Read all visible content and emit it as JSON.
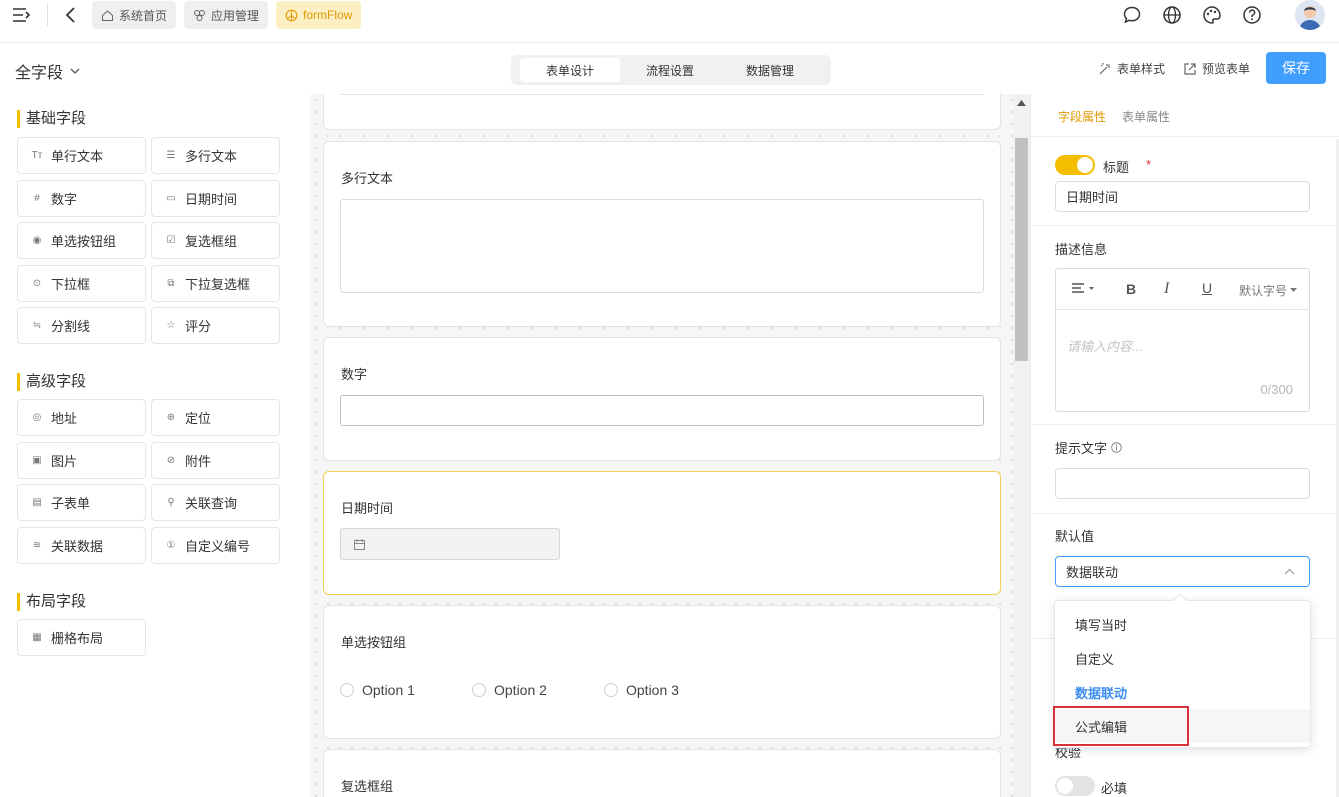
{
  "topbar": {
    "crumbs": [
      {
        "label": "系统首页",
        "icon": "home-icon"
      },
      {
        "label": "应用管理",
        "icon": "apps-icon"
      },
      {
        "label": "formFlow",
        "icon": "app-logo-icon"
      }
    ],
    "icons": [
      "menu-fold-icon",
      "back-icon",
      "message-icon",
      "globe-icon",
      "palette-icon",
      "help-icon",
      "user-avatar"
    ]
  },
  "subbar": {
    "title": "全字段",
    "tabs": [
      "表单设计",
      "流程设置",
      "数据管理"
    ],
    "active_tab": "表单设计",
    "form_style_label": "表单样式",
    "preview_label": "预览表单",
    "save_label": "保存"
  },
  "left": {
    "groups": [
      {
        "title": "基础字段",
        "items": [
          {
            "label": "单行文本",
            "icon": "text-icon"
          },
          {
            "label": "多行文本",
            "icon": "multiline-icon"
          },
          {
            "label": "数字",
            "icon": "hash-icon"
          },
          {
            "label": "日期时间",
            "icon": "calendar-icon"
          },
          {
            "label": "单选按钮组",
            "icon": "radio-icon"
          },
          {
            "label": "复选框组",
            "icon": "checkbox-icon"
          },
          {
            "label": "下拉框",
            "icon": "select-icon"
          },
          {
            "label": "下拉复选框",
            "icon": "multiselect-icon"
          },
          {
            "label": "分割线",
            "icon": "divider-icon"
          },
          {
            "label": "评分",
            "icon": "star-icon"
          }
        ]
      },
      {
        "title": "高级字段",
        "items": [
          {
            "label": "地址",
            "icon": "address-icon"
          },
          {
            "label": "定位",
            "icon": "location-icon"
          },
          {
            "label": "图片",
            "icon": "image-icon"
          },
          {
            "label": "附件",
            "icon": "attachment-icon"
          },
          {
            "label": "子表单",
            "icon": "table-icon"
          },
          {
            "label": "关联查询",
            "icon": "search-icon"
          },
          {
            "label": "关联数据",
            "icon": "database-icon"
          },
          {
            "label": "自定义编号",
            "icon": "number-icon"
          }
        ]
      },
      {
        "title": "布局字段",
        "items": [
          {
            "label": "栅格布局",
            "icon": "grid-icon"
          }
        ]
      }
    ]
  },
  "canvas": {
    "cards": [
      {
        "label": "多行文本"
      },
      {
        "label": "数字"
      },
      {
        "label": "日期时间"
      },
      {
        "label": "单选按钮组"
      },
      {
        "label": "复选框组"
      }
    ],
    "radio_options": [
      "Option 1",
      "Option 2",
      "Option 3"
    ]
  },
  "right": {
    "tabs": [
      "字段属性",
      "表单属性"
    ],
    "active_tab": "字段属性",
    "title_label": "标题",
    "required_mark": "*",
    "title_value": "日期时间",
    "desc_label": "描述信息",
    "editor_font_label": "默认字号",
    "desc_placeholder": "请输入内容...",
    "desc_counter": "0/300",
    "hint_label": "提示文字",
    "default_label": "默认值",
    "default_value": "数据联动",
    "validate_label": "校验",
    "required_label": "必填"
  },
  "dropdown": {
    "options": [
      "填写当时",
      "自定义",
      "数据联动",
      "公式编辑"
    ],
    "selected": "数据联动",
    "hovered": "公式编辑"
  },
  "colors": {
    "accent": "#f5bd00",
    "primary": "#3f8ef0",
    "highlight": "#d9303a"
  }
}
